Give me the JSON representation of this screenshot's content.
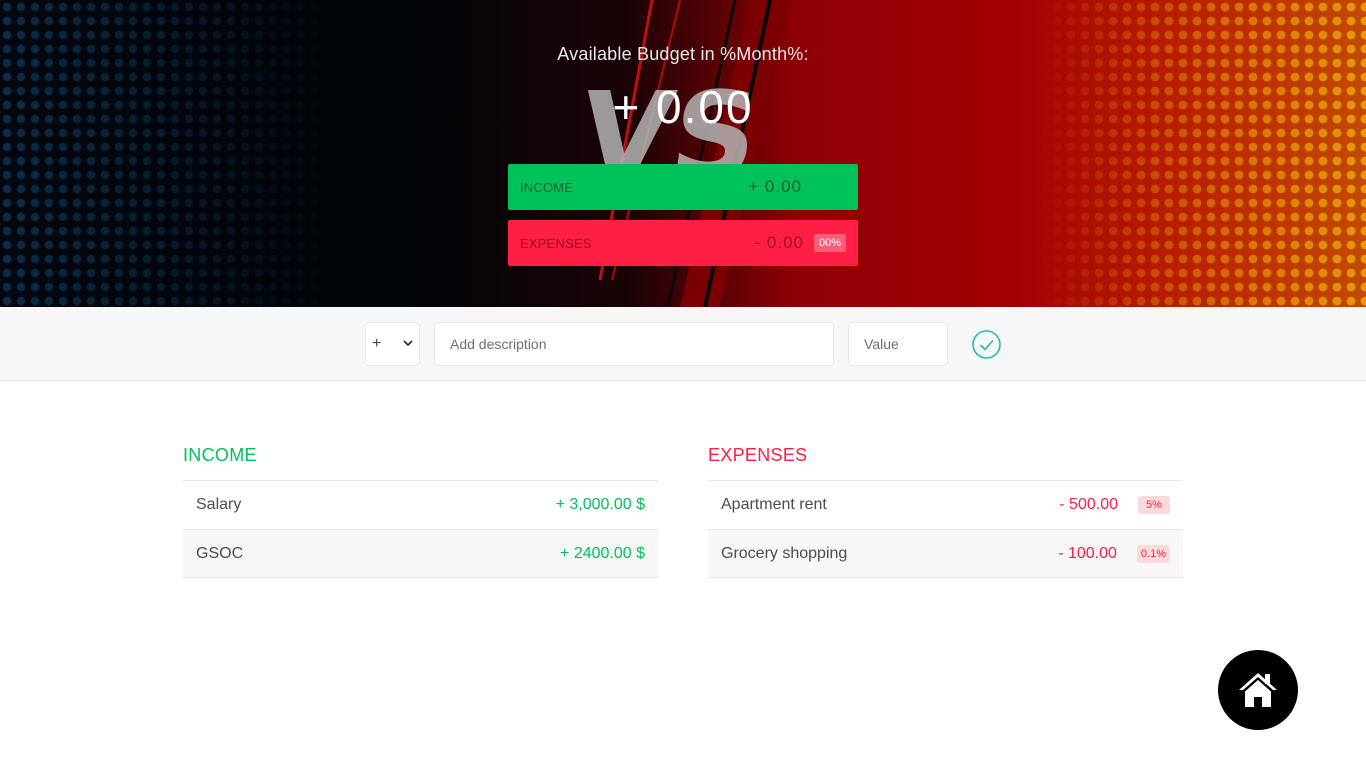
{
  "header": {
    "title": "Available Budget in %Month%:",
    "budget_value": "+ 0.00",
    "background_logo_text": "VS",
    "income_label": "INCOME",
    "income_value": "+ 0.00",
    "expenses_label": "EXPENSES",
    "expenses_value": "- 0.00",
    "expenses_percentage": "00%"
  },
  "add_form": {
    "type_selected": "+",
    "description_placeholder": "Add description",
    "value_placeholder": "Value",
    "submit_icon": "checkmark-circle-icon"
  },
  "income": {
    "title": "INCOME",
    "items": [
      {
        "description": "Salary",
        "value": "+ 3,000.00 $"
      },
      {
        "description": "GSOC",
        "value": "+ 2400.00 $"
      }
    ]
  },
  "expenses": {
    "title": "EXPENSES",
    "items": [
      {
        "description": "Apartment rent",
        "value": "- 500.00",
        "percentage": "5%"
      },
      {
        "description": "Grocery shopping",
        "value": "- 100.00",
        "percentage": "0.1%"
      }
    ]
  },
  "fab": {
    "icon": "home-icon"
  },
  "colors": {
    "income_green": "#00c25a",
    "expense_red": "#ff1f44",
    "accent_teal": "#28b9b5",
    "fab_black": "#000000"
  }
}
